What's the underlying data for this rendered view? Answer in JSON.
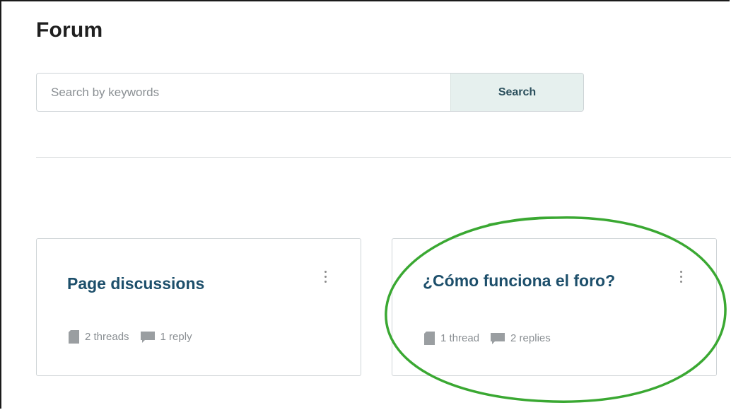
{
  "page": {
    "title": "Forum"
  },
  "search": {
    "placeholder": "Search by keywords",
    "value": "",
    "button_label": "Search"
  },
  "forums": [
    {
      "title": "Page discussions",
      "threads": "2 threads",
      "replies": "1 reply",
      "icons": [
        "document-icon",
        "comment-icon",
        "more-options-icon"
      ]
    },
    {
      "title": "¿Cómo funciona el foro?",
      "threads": "1 thread",
      "replies": "2 replies",
      "icons": [
        "document-icon",
        "comment-icon",
        "more-options-icon"
      ]
    }
  ],
  "annotation": {
    "color": "#3aa832",
    "shape": "ellipse",
    "target": "¿Cómo funciona el foro?"
  },
  "colors": {
    "title_link": "#1d4f6b",
    "search_button_bg": "#e6f0ee",
    "meta_text": "#8a8f93"
  }
}
